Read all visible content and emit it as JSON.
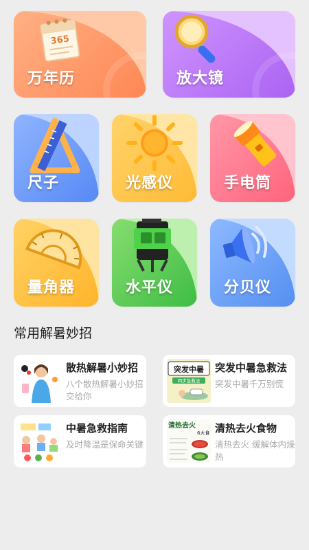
{
  "tools": [
    {
      "label": "万年历",
      "icon": "calendar-icon",
      "calendar_number": "365"
    },
    {
      "label": "放大镜",
      "icon": "magnifier-icon"
    },
    {
      "label": "尺子",
      "icon": "ruler-icon"
    },
    {
      "label": "光感仪",
      "icon": "sun-icon"
    },
    {
      "label": "手电筒",
      "icon": "flashlight-icon"
    },
    {
      "label": "量角器",
      "icon": "protractor-icon"
    },
    {
      "label": "水平仪",
      "icon": "laser-level-icon"
    },
    {
      "label": "分贝仪",
      "icon": "speaker-icon"
    }
  ],
  "section": {
    "title": "常用解暑妙招"
  },
  "articles": [
    {
      "title": "散热解暑小妙招",
      "desc": "八个散热解暑小妙招交给你"
    },
    {
      "title": "突发中暑急救法",
      "desc": "突发中暑千万别慌",
      "thumb_heading": "突发中暑",
      "thumb_sub": "四步急救法"
    },
    {
      "title": "中暑急救指南",
      "desc": "及时降温是保命关键"
    },
    {
      "title": "清热去火食物",
      "desc": "清热去火 缓解体内燥热",
      "thumb_heading": "清热去火",
      "thumb_sub": "6大食"
    }
  ],
  "colors": {
    "calendar": [
      "#ffb38a",
      "#ff8a5c"
    ],
    "magnifier": [
      "#d9a6ff",
      "#b36bf5"
    ],
    "ruler": [
      "#93b9ff",
      "#5b8ef7"
    ],
    "sun": [
      "#ffd978",
      "#ffbe3b"
    ],
    "flashlight": [
      "#ff9fae",
      "#ff6a80"
    ],
    "protractor": [
      "#ffd66b",
      "#ffb52e"
    ],
    "level": [
      "#8fe07a",
      "#45c048"
    ],
    "decibel": [
      "#94c0ff",
      "#5a94f3"
    ]
  }
}
